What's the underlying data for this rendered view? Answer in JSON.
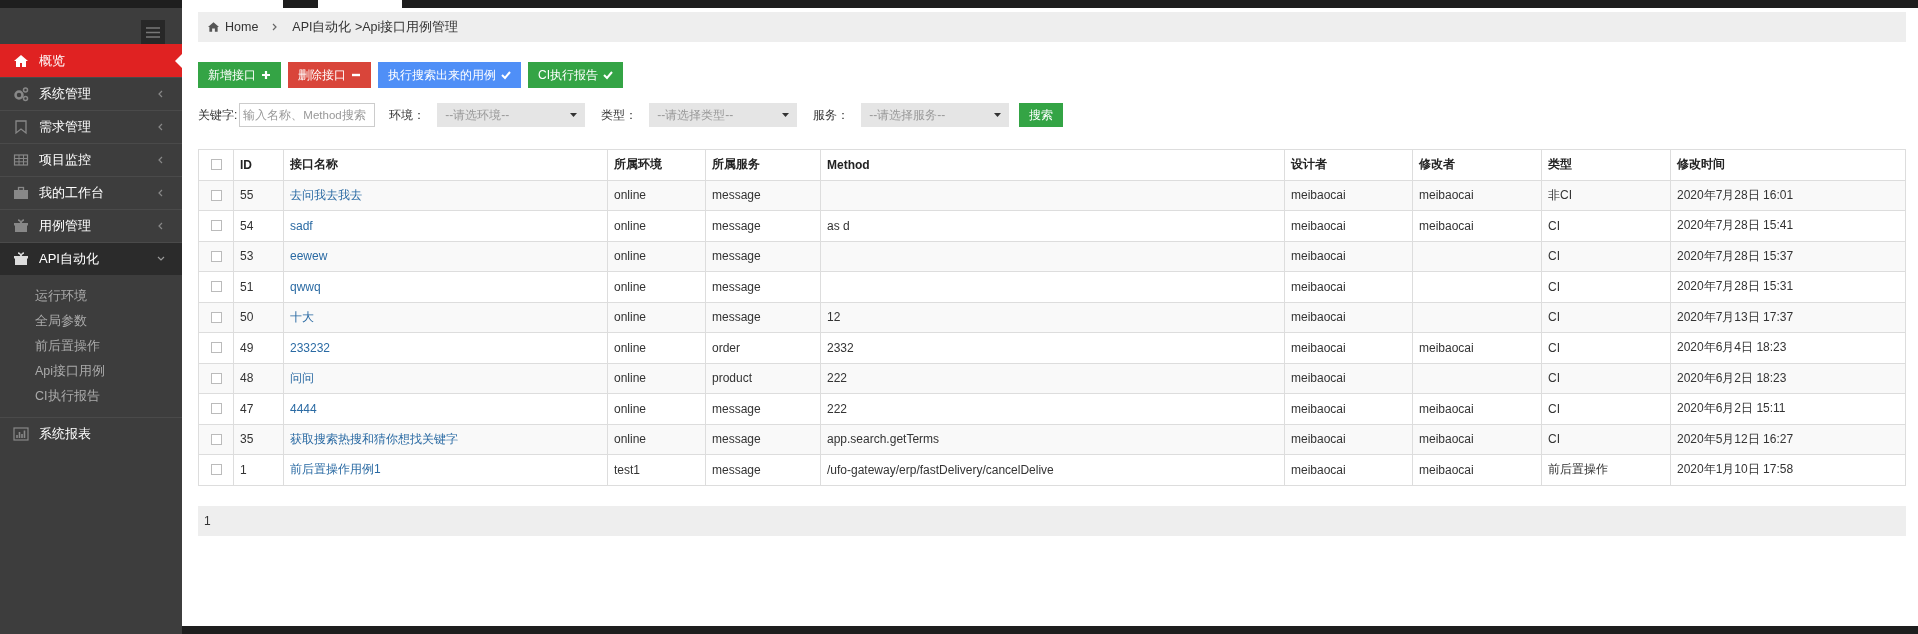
{
  "sidebar": {
    "items": [
      {
        "label": "概览",
        "kind": "link",
        "selected": true
      },
      {
        "label": "系统管理",
        "kind": "menu",
        "selected": false,
        "expanded": false
      },
      {
        "label": "需求管理",
        "kind": "menu",
        "selected": false,
        "expanded": false
      },
      {
        "label": "项目监控",
        "kind": "menu",
        "selected": false,
        "expanded": false
      },
      {
        "label": "我的工作台",
        "kind": "menu",
        "selected": false,
        "expanded": false
      },
      {
        "label": "用例管理",
        "kind": "menu",
        "selected": false,
        "expanded": false
      },
      {
        "label": "API自动化",
        "kind": "menu",
        "selected": false,
        "expanded": true,
        "children": [
          {
            "label": "运行环境",
            "selected": false
          },
          {
            "label": "全局参数",
            "selected": false
          },
          {
            "label": "前后置操作",
            "selected": false
          },
          {
            "label": "Api接口用例",
            "selected": false
          },
          {
            "label": "CI执行报告",
            "selected": false
          }
        ]
      },
      {
        "label": "系统报表",
        "kind": "link",
        "selected": false
      }
    ]
  },
  "breadcrumb": [
    "Home",
    "API自动化 >Api接口用例管理"
  ],
  "toolbar": [
    {
      "label": "新增接口",
      "kind": "add"
    },
    {
      "label": "删除接口",
      "kind": "delete"
    },
    {
      "label": "执行搜索出来的用例",
      "kind": "run"
    },
    {
      "label": "CI执行报告",
      "kind": "report"
    }
  ],
  "filters": {
    "keyword": {
      "label": "关键字:",
      "placeholder": "输入名称、Method搜索"
    },
    "selects": [
      {
        "label": "环境：",
        "value": "--请选环境--"
      },
      {
        "label": "类型：",
        "value": "--请选择类型--"
      },
      {
        "label": "服务：",
        "value": "--请选择服务--"
      }
    ],
    "search_button": "搜索"
  },
  "table": {
    "select_all": {
      "checked": false
    },
    "columns": [
      "ID",
      "接口名称",
      "所属环境",
      "所属服务",
      "Method",
      "设计者",
      "修改者",
      "类型",
      "修改时间"
    ],
    "rows": [
      {
        "checked": false,
        "id": "55",
        "name": "去问我去我去",
        "env": "online",
        "service": "message",
        "designer": "meibaocai",
        "modifier": "meibaocai",
        "type": "非CI",
        "modified": "2020年7月28日 16:01"
      },
      {
        "checked": false,
        "id": "54",
        "name": "sadf",
        "env": "online",
        "service": "message",
        "method": "as d",
        "designer": "meibaocai",
        "modifier": "meibaocai",
        "type": "CI",
        "modified": "2020年7月28日 15:41"
      },
      {
        "checked": false,
        "id": "53",
        "name": "eewew",
        "env": "online",
        "service": "message",
        "designer": "meibaocai",
        "type": "CI",
        "modified": "2020年7月28日 15:37"
      },
      {
        "checked": false,
        "id": "51",
        "name": "qwwq",
        "env": "online",
        "service": "message",
        "designer": "meibaocai",
        "type": "CI",
        "modified": "2020年7月28日 15:31"
      },
      {
        "checked": false,
        "id": "50",
        "name": "十大",
        "env": "online",
        "service": "message",
        "method": "12",
        "designer": "meibaocai",
        "type": "CI",
        "modified": "2020年7月13日 17:37"
      },
      {
        "checked": false,
        "id": "49",
        "name": "233232",
        "env": "online",
        "service": "order",
        "method": "2332",
        "designer": "meibaocai",
        "modifier": "meibaocai",
        "type": "CI",
        "modified": "2020年6月4日 18:23"
      },
      {
        "checked": false,
        "id": "48",
        "name": "问问",
        "env": "online",
        "service": "product",
        "method": "222",
        "designer": "meibaocai",
        "type": "CI",
        "modified": "2020年6月2日 18:23"
      },
      {
        "checked": false,
        "id": "47",
        "name": "4444",
        "env": "online",
        "service": "message",
        "method": "222",
        "designer": "meibaocai",
        "modifier": "meibaocai",
        "type": "CI",
        "modified": "2020年6月2日 15:11"
      },
      {
        "checked": false,
        "id": "35",
        "name": "获取搜索热搜和猜你想找关键字",
        "env": "online",
        "service": "message",
        "method": "app.search.getTerms",
        "designer": "meibaocai",
        "modifier": "meibaocai",
        "type": "CI",
        "modified": "2020年5月12日 16:27"
      },
      {
        "checked": false,
        "id": "1",
        "name": "前后置操作用例1",
        "env": "test1",
        "service": "message",
        "method": "/ufo-gateway/erp/fastDelivery/cancelDelive",
        "designer": "meibaocai",
        "modifier": "meibaocai",
        "type": "前后置操作",
        "modified": "2020年1月10日 17:58"
      }
    ]
  },
  "pagination": {
    "current": "1"
  }
}
